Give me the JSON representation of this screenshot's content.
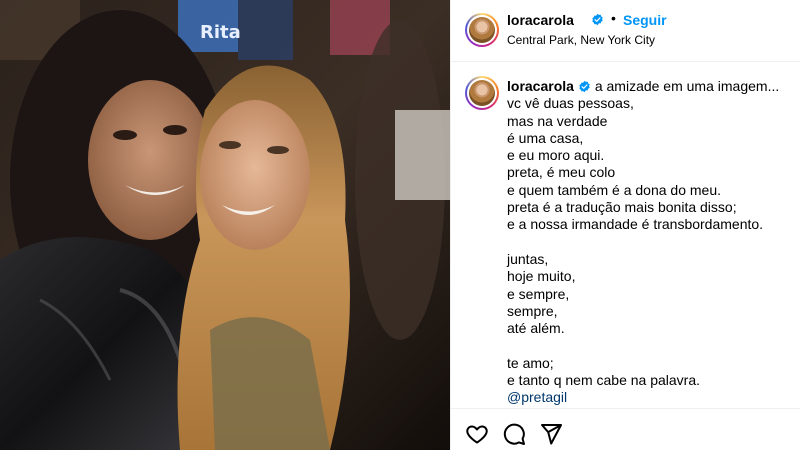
{
  "post": {
    "username": "loracarola",
    "follow_label": "Seguir",
    "separator": "•",
    "location": "Central Park, New York City",
    "photo_sign_text": "Rita"
  },
  "caption": {
    "username": "loracarola",
    "lines": [
      "a amizade em uma imagem...",
      "vc vê duas pessoas,",
      "mas na verdade",
      "é uma casa,",
      "e eu moro aqui.",
      "preta, é meu colo",
      "e quem também é a dona do meu.",
      "preta é a tradução mais bonita disso;",
      "e a nossa irmandade é transbordamento.",
      "",
      "juntas,",
      "hoje muito,",
      "e sempre,",
      "sempre,",
      "até além.",
      "",
      "te amo;",
      "e tanto q nem cabe na palavra."
    ],
    "mention": "@pretagil"
  },
  "actions": {
    "like": "heart-icon",
    "comment": "comment-icon",
    "share": "share-icon"
  },
  "colors": {
    "link_blue": "#0095f6",
    "verified_blue": "#0095f6",
    "mention_blue": "#00376b",
    "divider": "#efefef"
  }
}
